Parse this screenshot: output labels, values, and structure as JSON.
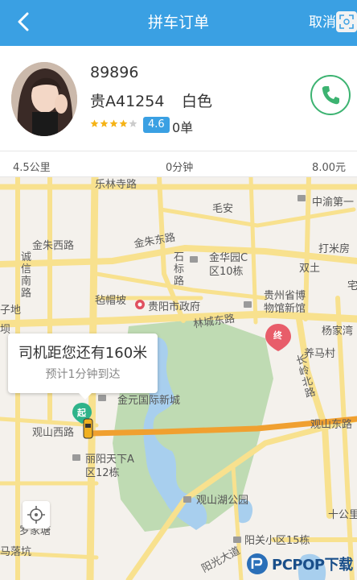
{
  "header": {
    "title": "拼车订单",
    "cancel_label": "取消"
  },
  "driver": {
    "name": "89896",
    "plate": "贵A41254",
    "car_color": "白色",
    "rating": "4.6",
    "stars_filled": 4,
    "stars_total": 5,
    "orders": "0单"
  },
  "stats": {
    "distance": "4.5公里",
    "duration": "0分钟",
    "price": "8.00元"
  },
  "map": {
    "labels": {
      "road_1": "乐林寺路",
      "place_1": "中渝第一",
      "place_2": "毛安",
      "road_2": "金朱东路",
      "road_3": "金朱西路",
      "road_4": "诚信南路",
      "place_3": "子地",
      "road_5": "石标路",
      "poi_1": "金华园C区10栋",
      "poi_2": "双土",
      "poi_3": "打米房",
      "poi_4": "毡帽坡",
      "poi_5": "贵阳市政府",
      "poi_6": "贵州省博物馆新馆",
      "road_6": "林城东路",
      "poi_7": "杨家湾",
      "poi_8": "养马村",
      "road_7": "长岭北路",
      "poi_9": "金元国际新城",
      "road_8": "观山西路",
      "road_9": "观山东路",
      "poi_10": "丽阳天下A区12栋",
      "poi_11": "观山湖公园",
      "poi_12": "十公里",
      "poi_13": "罗家塘",
      "poi_14": "马落坑",
      "poi_15": "阳关小区15栋",
      "road_10": "阳光大道",
      "place_4": "宅",
      "place_5": "坝",
      "terminus": "终",
      "origin": "起"
    },
    "bubble": {
      "main": "司机距您还有160米",
      "sub": "预计1分钟到达"
    }
  },
  "watermark": {
    "text": "PCPOP下载"
  },
  "colors": {
    "header": "#3aa0e3",
    "phone": "#3cb371",
    "route": "#f0a030",
    "park": "#bfdbb3",
    "water": "#a8cfee",
    "road": "#f8e18e"
  }
}
